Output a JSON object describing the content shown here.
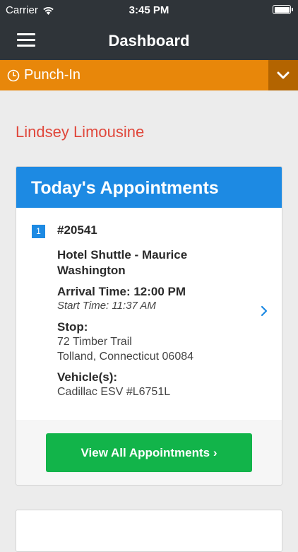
{
  "status_bar": {
    "carrier": "Carrier",
    "time": "3:45 PM"
  },
  "nav": {
    "title": "Dashboard"
  },
  "punch": {
    "label": "Punch-In"
  },
  "company": "Lindsey Limousine",
  "appointments": {
    "header": "Today's Appointments",
    "items": [
      {
        "index": "1",
        "number": "#20541",
        "name": "Hotel Shuttle - Maurice Washington",
        "arrival": "Arrival Time: 12:00 PM",
        "start": "Start Time: 11:37 AM",
        "stop_label": "Stop:",
        "stop_line1": "72 Timber Trail",
        "stop_line2": "Tolland, Connecticut 06084",
        "vehicle_label": "Vehicle(s):",
        "vehicle": "Cadillac ESV #L6751L"
      }
    ],
    "view_all": "View All Appointments ›"
  },
  "colors": {
    "header_dark": "#2f3439",
    "punch_orange": "#e8870a",
    "accent_blue": "#1d8ae3",
    "brand_red": "#e0483c",
    "button_green": "#12b44a"
  }
}
